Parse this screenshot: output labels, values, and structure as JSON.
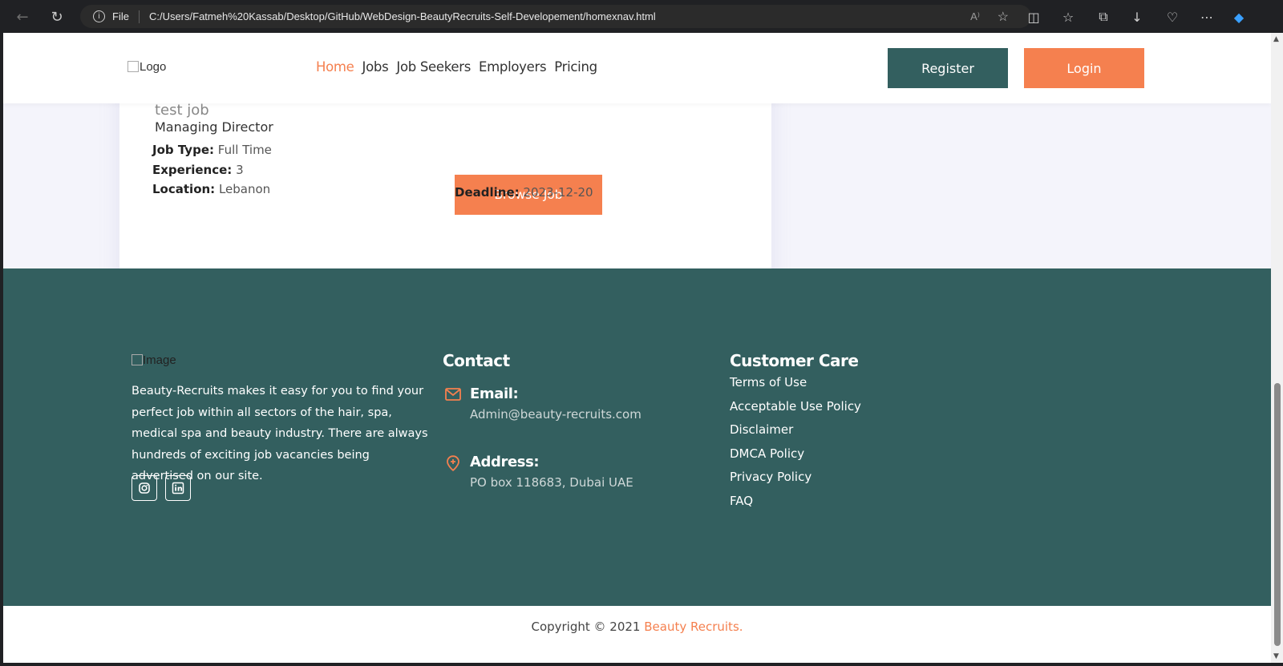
{
  "browser": {
    "scheme": "File",
    "url": "C:/Users/Fatmeh%20Kassab/Desktop/GitHub/WebDesign-BeautyRecruits-Self-Developement/homexnav.html",
    "read_aloud": "A⁾"
  },
  "header": {
    "logo_alt": "Logo",
    "nav": [
      {
        "label": "Home",
        "active": true
      },
      {
        "label": "Jobs",
        "active": false
      },
      {
        "label": "Job Seekers",
        "active": false
      },
      {
        "label": "Employers",
        "active": false
      },
      {
        "label": "Pricing",
        "active": false
      }
    ],
    "register_label": "Register",
    "login_label": "Login"
  },
  "job": {
    "title": "test job",
    "company": "Managing Director",
    "job_type_label": "Job Type:",
    "job_type_value": "Full Time",
    "experience_label": "Experience:",
    "experience_value": "3",
    "location_label": "Location:",
    "location_value": "Lebanon",
    "browse_label": "Browse Job",
    "deadline_label": "Deadline:",
    "deadline_value": "2023-12-20"
  },
  "footer": {
    "image_alt": "Image",
    "about": "Beauty-Recruits makes it easy for you to find your perfect job within all sectors of the hair, spa, medical spa and beauty industry. There are always hundreds of exciting job vacancies being advertised on our site.",
    "contact_heading": "Contact",
    "email_label": "Email:",
    "email_value": "Admin@beauty-recruits.com",
    "address_label": "Address:",
    "address_value": "PO box 118683, Dubai UAE",
    "care_heading": "Customer Care",
    "care_links": [
      "Terms of Use",
      "Acceptable Use Policy",
      "Disclaimer",
      "DMCA Policy",
      "Privacy Policy",
      "FAQ"
    ]
  },
  "copyright": {
    "text": "Copyright © 2021 ",
    "brand": "Beauty Recruits."
  },
  "colors": {
    "accent": "#f5804f",
    "teal": "#335f5f"
  }
}
